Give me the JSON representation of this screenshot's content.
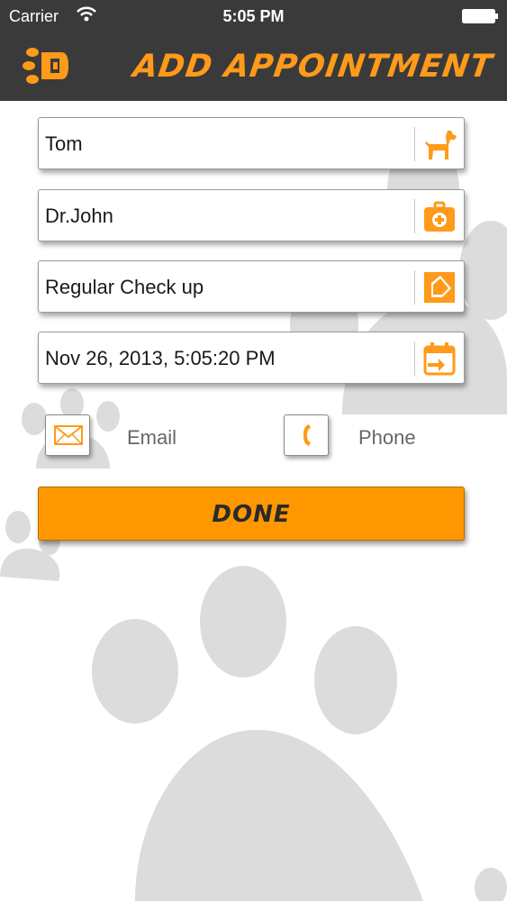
{
  "status_bar": {
    "carrier": "Carrier",
    "time": "5:05 PM"
  },
  "nav": {
    "title": "ADD APPOINTMENT",
    "logo_icon": "paw-logo-icon"
  },
  "form": {
    "pet_name": {
      "value": "Tom",
      "icon": "dog-icon"
    },
    "doctor": {
      "value": "Dr.John",
      "icon": "medical-kit-icon"
    },
    "purpose": {
      "value": "Regular Check up",
      "icon": "note-icon"
    },
    "datetime": {
      "value": "Nov 26, 2013, 5:05:20 PM",
      "icon": "calendar-icon"
    }
  },
  "contact": {
    "email_label": "Email",
    "phone_label": "Phone"
  },
  "done_label": "DONE",
  "colors": {
    "accent": "#ff9700",
    "bar": "#3a3a3a",
    "paw": "#d9d9d9"
  }
}
